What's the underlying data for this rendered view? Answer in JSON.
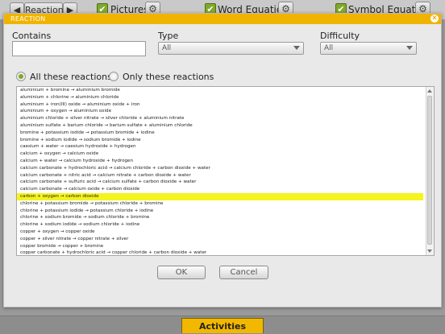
{
  "toolbar": {
    "back_arrow": "◀",
    "reaction_label": "Reaction",
    "forward_arrow": "▶",
    "pictures_label": "Pictures",
    "word_equation_label": "Word Equation",
    "symbol_equation_label": "Symbol Equation",
    "check_glyph": "✔",
    "gear_glyph": "⚙"
  },
  "modal": {
    "title": "REACTION",
    "close_glyph": "✕",
    "contains_label": "Contains",
    "contains_value": "",
    "type_label": "Type",
    "type_value": "All",
    "difficulty_label": "Difficulty",
    "difficulty_value": "All",
    "radio_all_label": "All these reactions",
    "radio_only_label": "Only these reactions",
    "selected_radio": "all",
    "reactions": [
      "aluminium + bromine → aluminium bromide",
      "aluminium + chlorine → aluminium chloride",
      "aluminium + iron(III) oxide → aluminium oxide + iron",
      "aluminium + oxygen → aluminium oxide",
      "aluminium chloride + silver nitrate → silver chloride + aluminium nitrate",
      "aluminium sulfate + barium chloride → barium sulfate + aluminium chloride",
      "bromine + potassium iodide → potassium bromide + iodine",
      "bromine + sodium iodide → sodium bromide + iodine",
      "caesium + water → caesium hydroxide + hydrogen",
      "calcium + oxygen → calcium oxide",
      "calcium + water → calcium hydroxide + hydrogen",
      "calcium carbonate + hydrochloric acid → calcium chloride + carbon dioxide + water",
      "calcium carbonate + nitric acid → calcium nitrate + carbon dioxide + water",
      "calcium carbonate + sulfuric acid → calcium sulfate + carbon dioxide + water",
      "calcium carbonate → calcium oxide + carbon dioxide",
      "carbon + oxygen → carbon dioxide",
      "chlorine + potassium bromide → potassium chloride + bromine",
      "chlorine + potassium iodide → potassium chloride + iodine",
      "chlorine + sodium bromide → sodium chloride + bromine",
      "chlorine + sodium iodide → sodium chloride + iodine",
      "copper + oxygen → copper oxide",
      "copper + silver nitrate → copper nitrate + silver",
      "copper bromide → copper + bromine",
      "copper carbonate + hydrochloric acid → copper chloride + carbon dioxide + water",
      "copper carbonate + nitric acid → copper nitrate + carbon dioxide + water"
    ],
    "selected_index": 15,
    "ok_label": "OK",
    "cancel_label": "Cancel"
  },
  "bottom": {
    "activities_label": "Activities"
  },
  "colors": {
    "accent": "#f0b400",
    "check_green": "#7fa92a",
    "selection": "#f4f41e"
  }
}
